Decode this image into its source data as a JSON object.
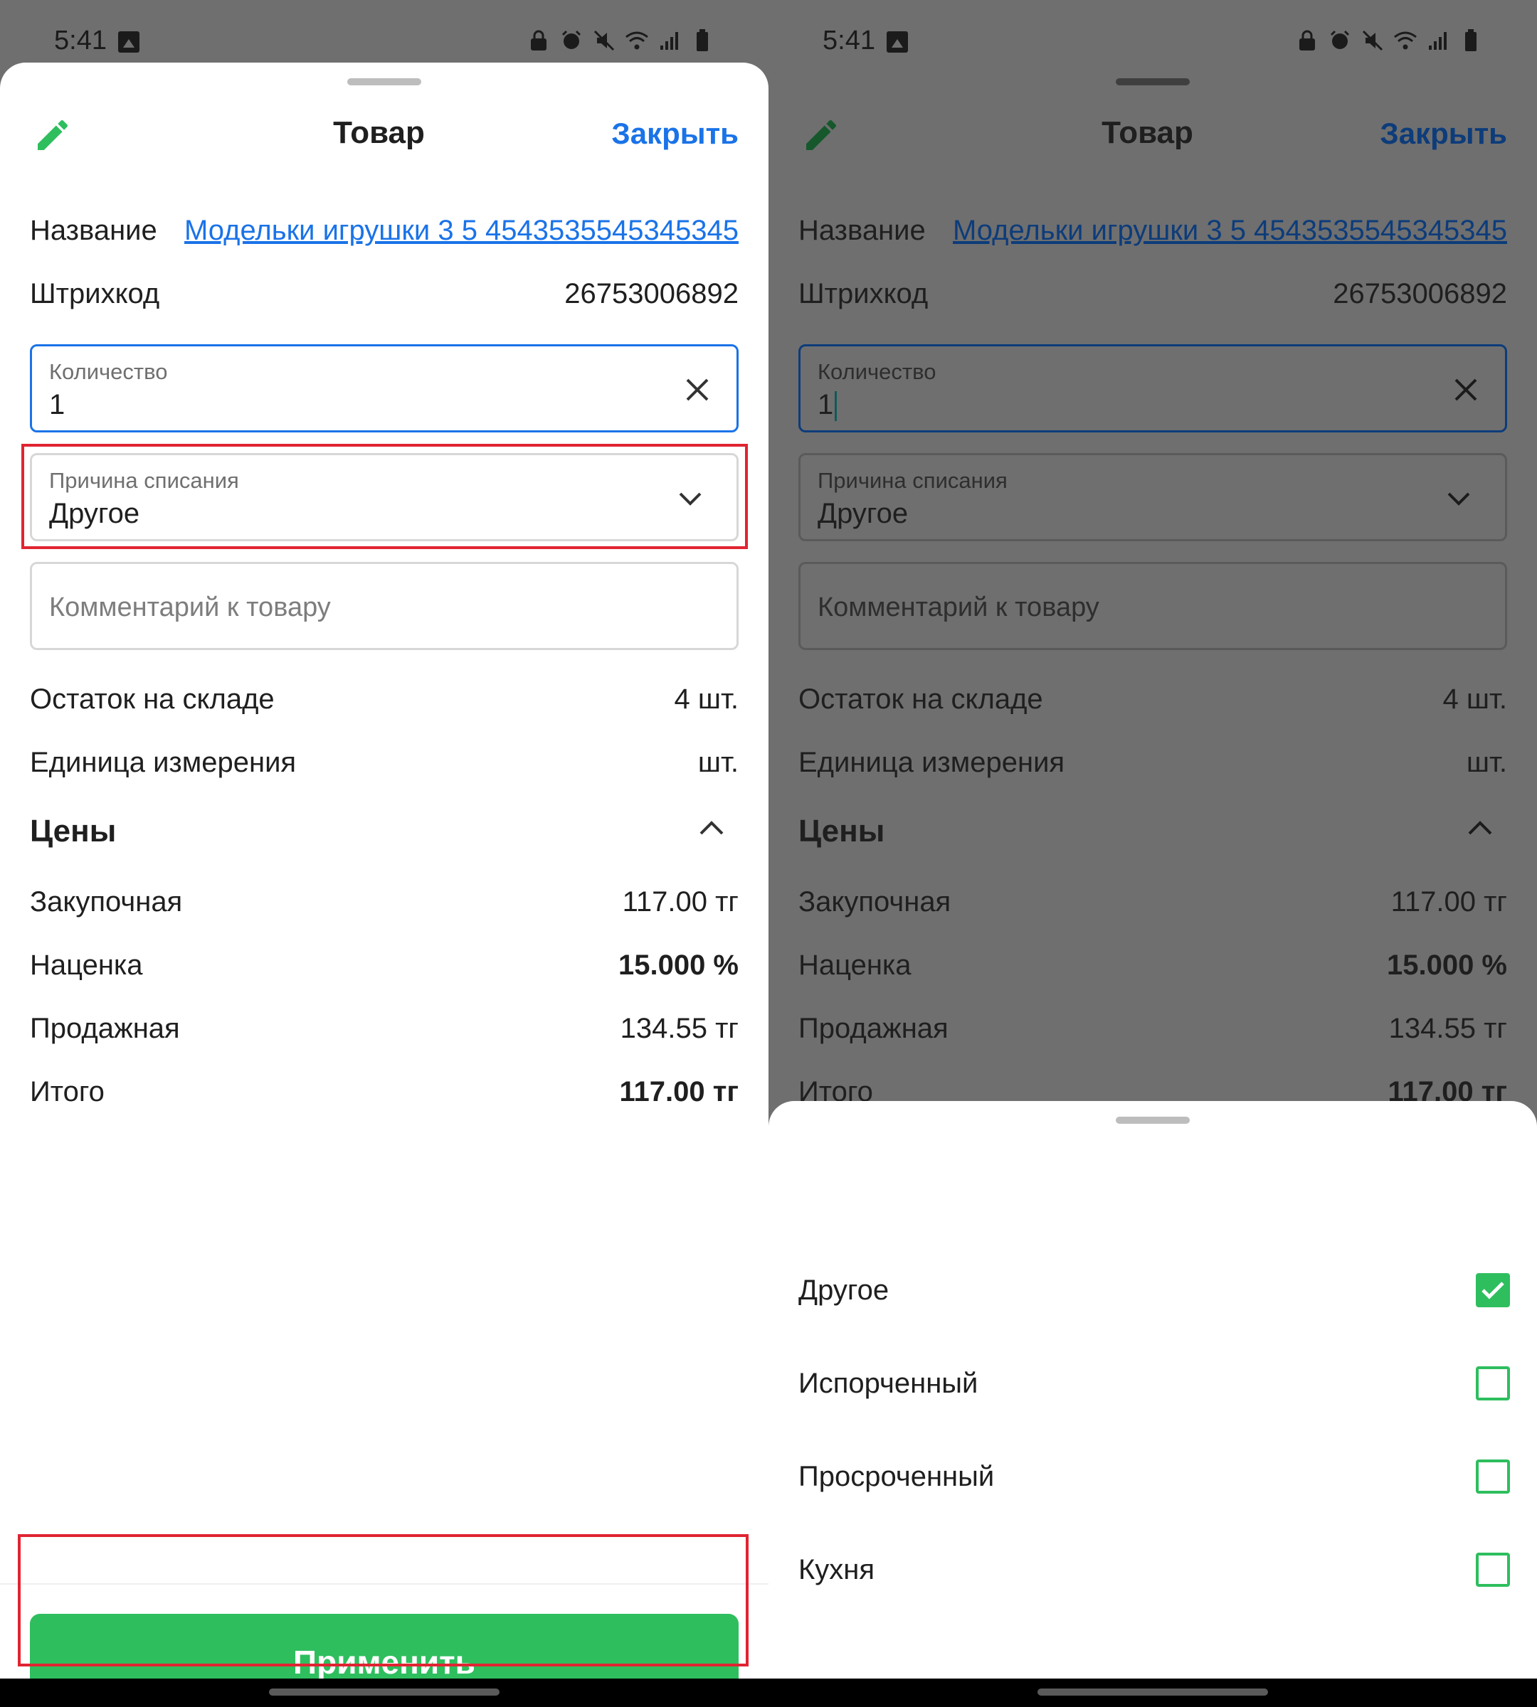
{
  "status": {
    "time": "5:41"
  },
  "sheet": {
    "title": "Товар",
    "close_label": "Закрыть",
    "name_label": "Название",
    "name_value": "Модельки игрушки 3 5 4543535545345345",
    "barcode_label": "Штрихкод",
    "barcode_value": "26753006892",
    "quantity": {
      "label": "Количество",
      "value": "1"
    },
    "reason": {
      "label": "Причина списания",
      "value": "Другое"
    },
    "comment": {
      "placeholder": "Комментарий к товару"
    },
    "stock_label": "Остаток на складе",
    "stock_value": "4 шт.",
    "unit_label": "Единица измерения",
    "unit_value": "шт.",
    "prices": {
      "title": "Цены",
      "purchase_label": "Закупочная",
      "purchase_value": "117.00 тг",
      "markup_label": "Наценка",
      "markup_value": "15.000 %",
      "sale_label": "Продажная",
      "sale_value": "134.55 тг",
      "total_label": "Итого",
      "total_value": "117.00 тг"
    },
    "apply_label": "Применить"
  },
  "picker": {
    "options": [
      {
        "label": "Другое",
        "checked": true
      },
      {
        "label": "Испорченный",
        "checked": false
      },
      {
        "label": "Просроченный",
        "checked": false
      },
      {
        "label": "Кухня",
        "checked": false
      }
    ]
  },
  "colors": {
    "accent_green": "#2ebe5e",
    "link_blue": "#1a73e8",
    "highlight_red": "#e02432",
    "scrim": "#6f6f6f"
  },
  "icons": [
    "pencil-icon",
    "close-icon",
    "chevron-down-icon",
    "chevron-up-icon",
    "checkbox-icon"
  ]
}
